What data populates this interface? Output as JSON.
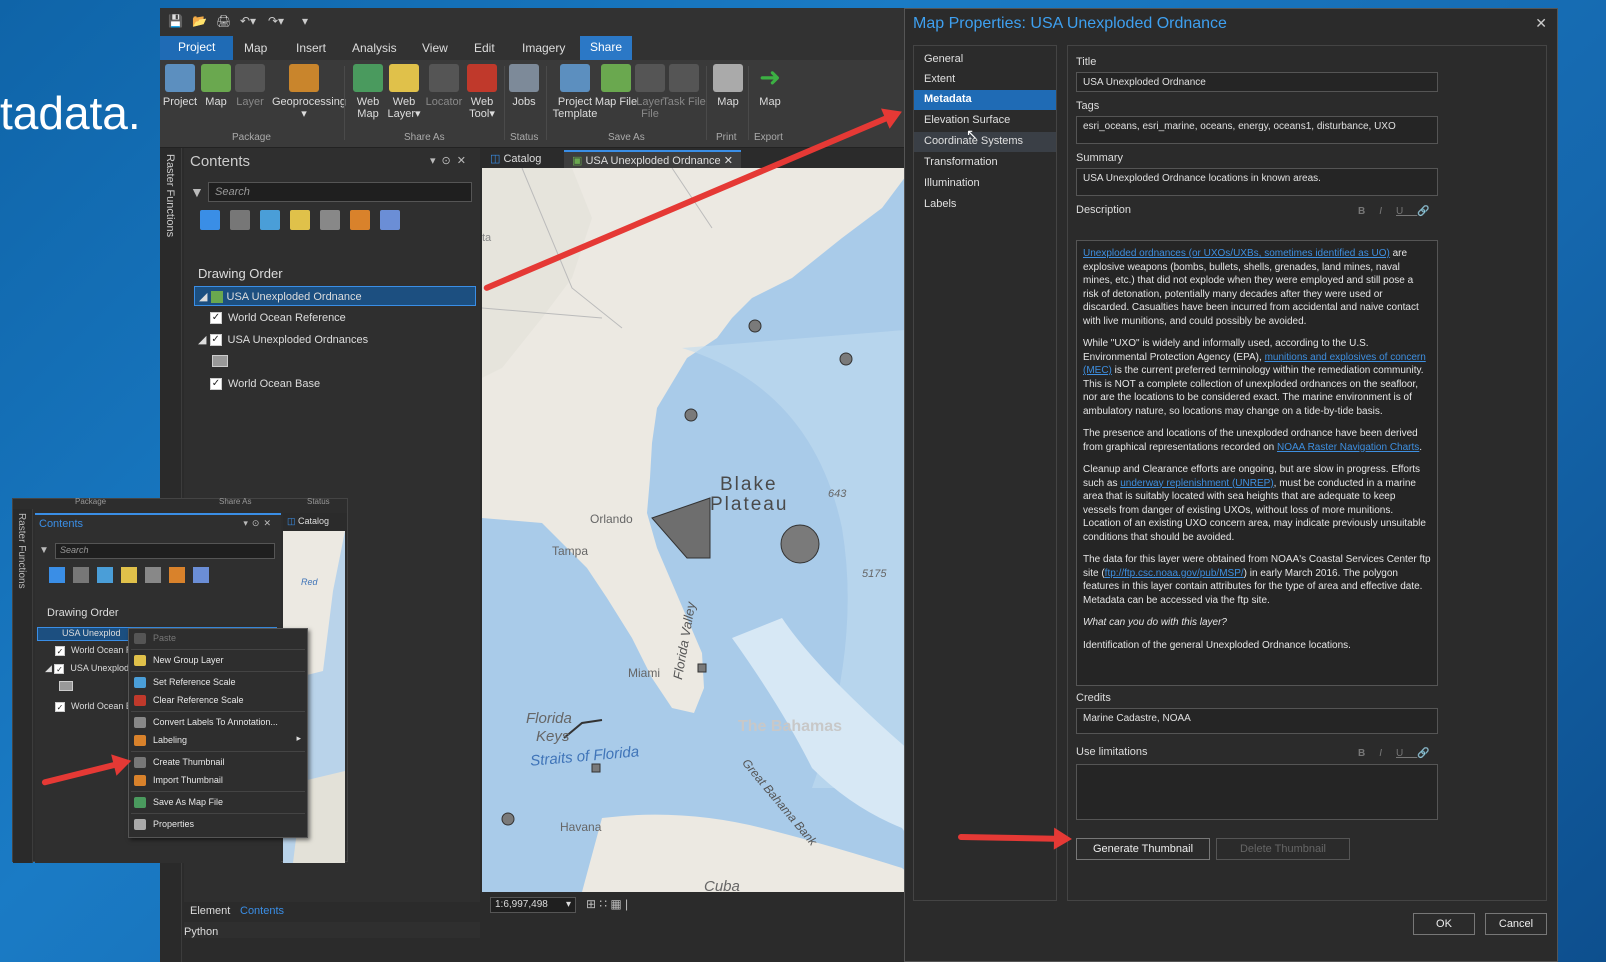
{
  "slide_heading": "tadata.",
  "qat_icons": [
    "save-icon",
    "open-icon",
    "print-icon",
    "undo-icon",
    "redo-icon",
    "customize-icon"
  ],
  "ribbon": {
    "tabs": [
      "Project",
      "Map",
      "Insert",
      "Analysis",
      "View",
      "Edit",
      "Imagery",
      "Share"
    ],
    "active_tab": "Share",
    "buttons": [
      {
        "label": "Project",
        "group": "Package"
      },
      {
        "label": "Map",
        "group": "Package"
      },
      {
        "label": "Layer",
        "group": "Package",
        "disabled": true
      },
      {
        "label": "Geoprocessing",
        "group": "Package"
      },
      {
        "label": "Web Map",
        "group": "Share As"
      },
      {
        "label": "Web Layer",
        "group": "Share As"
      },
      {
        "label": "Locator",
        "group": "Share As",
        "disabled": true
      },
      {
        "label": "Web Tool",
        "group": "Share As"
      },
      {
        "label": "Jobs",
        "group": "Status"
      },
      {
        "label": "Project Template",
        "group": "Save As"
      },
      {
        "label": "Map File",
        "group": "Save As"
      },
      {
        "label": "Layer File",
        "group": "Save As",
        "disabled": true
      },
      {
        "label": "Task File",
        "group": "Save As",
        "disabled": true
      },
      {
        "label": "Map",
        "group": "Print"
      },
      {
        "label": "Map",
        "group": "Export"
      }
    ],
    "groups": [
      "Package",
      "Share As",
      "Status",
      "Save As",
      "Print",
      "Export"
    ]
  },
  "side_strip_label": "Raster Functions",
  "contents": {
    "title": "Contents",
    "search_placeholder": "Search",
    "drawing_order": "Drawing Order",
    "layers": [
      {
        "name": "USA Unexploded Ordnance",
        "selected": true
      },
      {
        "name": "World Ocean Reference",
        "checked": true
      },
      {
        "name": "USA Unexploded Ordnances",
        "checked": true
      },
      {
        "name": "World Ocean Base",
        "checked": true
      }
    ],
    "bottom_tabs": [
      "Element",
      "Contents"
    ],
    "python": "Python"
  },
  "map_view": {
    "tabs": [
      "Catalog",
      "USA Unexploded Ordnance"
    ],
    "scale": "1:6,997,498",
    "labels": [
      "Blake",
      "Plateau",
      "Orlando",
      "Tampa",
      "Miami",
      "Florida",
      "Keys",
      "Straits of Florida",
      "Florida Valley",
      "The Bahamas",
      "Great Bahama Bank",
      "Havana",
      "Cuba",
      "ta",
      "643",
      "5175"
    ]
  },
  "mini_window": {
    "header_groups": [
      "Package",
      "Share As",
      "Status"
    ],
    "side_label": "Raster Functions",
    "contents_title": "Contents",
    "search_placeholder": "Search",
    "drawing_order": "Drawing Order",
    "layers": [
      "USA Unexplod",
      "World Ocean R",
      "USA Unexplod",
      "World Ocean B"
    ],
    "catalog_tab": "Catalog",
    "map_label": "Red",
    "context_menu": [
      {
        "label": "Paste",
        "disabled": true
      },
      {
        "label": "New Group Layer"
      },
      {
        "label": "Set Reference Scale"
      },
      {
        "label": "Clear Reference Scale"
      },
      {
        "label": "Convert Labels To Annotation..."
      },
      {
        "label": "Labeling",
        "submenu": true
      },
      {
        "label": "Create Thumbnail"
      },
      {
        "label": "Import Thumbnail"
      },
      {
        "label": "Save As Map File"
      },
      {
        "label": "Properties"
      }
    ]
  },
  "dialog": {
    "title": "Map Properties: USA Unexploded Ordnance",
    "nav": [
      "General",
      "Extent",
      "Metadata",
      "Elevation Surface",
      "Coordinate Systems",
      "Transformation",
      "Illumination",
      "Labels"
    ],
    "selected_nav": "Metadata",
    "fields": {
      "title_label": "Title",
      "title_value": "USA Unexploded Ordnance",
      "tags_label": "Tags",
      "tags_value": "esri_oceans, esri_marine, oceans, energy, oceans1, disturbance, UXO",
      "summary_label": "Summary",
      "summary_value": "USA Unexploded Ordnance locations in known areas.",
      "description_label": "Description",
      "credits_label": "Credits",
      "credits_value": "Marine Cadastre, NOAA",
      "use_limitations_label": "Use limitations"
    },
    "format_buttons": [
      "B",
      "I",
      "U",
      "link"
    ],
    "description": {
      "p1_link": "Unexploded ordnances (or UXOs/UXBs, sometimes identified as UO)",
      "p1_text": " are explosive weapons (bombs, bullets, shells, grenades, land mines, naval mines, etc.) that did not explode when they were employed and still pose a risk of detonation, potentially many decades after they were used or discarded. Casualties have been incurred from accidental and naive contact with live munitions, and could possibly be avoided.",
      "p2_a": "While \"UXO\" is widely and informally used, according to the U.S. Environmental Protection Agency (EPA), ",
      "p2_link": "munitions and explosives of concern (MEC)",
      "p2_b": " is the current preferred terminology within the remediation community. This is NOT a complete collection of unexploded ordnances on the seafloor, nor are the locations to be considered exact. The marine environment is of ambulatory nature, so locations may change on a tide-by-tide basis.",
      "p3_a": "The presence and locations of the unexploded ordnance have been derived from graphical representations recorded on ",
      "p3_link": "NOAA Raster Navigation Charts",
      "p3_b": ".",
      "p4_a": "Cleanup and Clearance efforts are ongoing, but are slow in progress. Efforts such as ",
      "p4_link": "underway replenishment (UNREP)",
      "p4_b": ", must be conducted in a marine area that is suitably located with sea heights that are adequate to keep vessels from danger of existing UXOs, without loss of more munitions. Location of an existing UXO concern area, may indicate previously unsuitable conditions that should be avoided.",
      "p5_a": "The data for this layer were obtained from NOAA's Coastal Services Center ftp site (",
      "p5_link": "ftp://ftp.csc.noaa.gov/pub/MSP/",
      "p5_b": ") in early March 2016. The polygon features in this layer contain attributes for the type of area and effective date. Metadata can be accessed via the ftp site.",
      "p6": "What can you do with this layer?",
      "p7": "Identification of the general Unexploded Ordnance locations."
    },
    "buttons": {
      "generate_thumbnail": "Generate Thumbnail",
      "delete_thumbnail": "Delete Thumbnail",
      "ok": "OK",
      "cancel": "Cancel"
    }
  },
  "colors": {
    "accent": "#3a8ee6",
    "arrow": "#e53935",
    "water": "#a9cbe9",
    "land": "#ece9e2"
  }
}
